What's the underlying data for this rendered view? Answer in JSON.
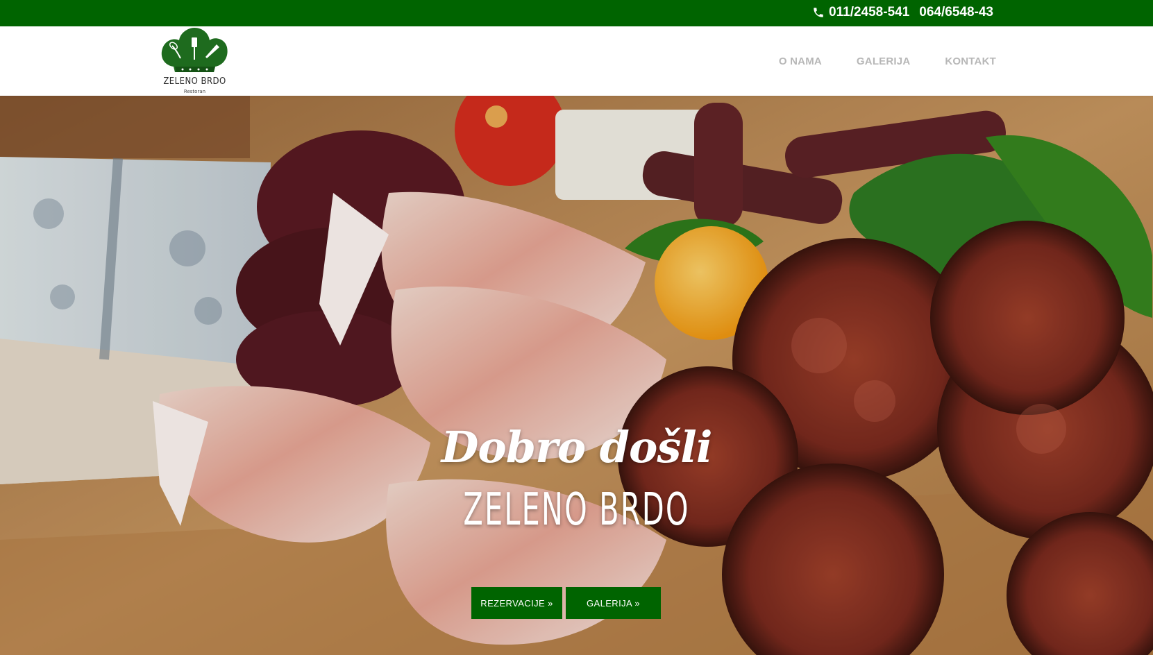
{
  "topbar": {
    "phone_icon": "phone-icon",
    "phone1": "011/2458-541",
    "phone2": "064/6548-43",
    "bg_color": "#006400"
  },
  "logo": {
    "name": "ZELENO BRDO",
    "sub": "Restoran",
    "icon": "chef-hat-logo"
  },
  "nav": {
    "items": [
      {
        "label": "O NAMA"
      },
      {
        "label": "GALERIJA"
      },
      {
        "label": "KONTAKT"
      }
    ]
  },
  "hero": {
    "title": "Dobro došli",
    "subtitle": "ZELENO BRDO",
    "buttons": {
      "reservations": "REZERVACIJE »",
      "gallery": "GALERIJA »"
    },
    "button_color": "#006400"
  }
}
